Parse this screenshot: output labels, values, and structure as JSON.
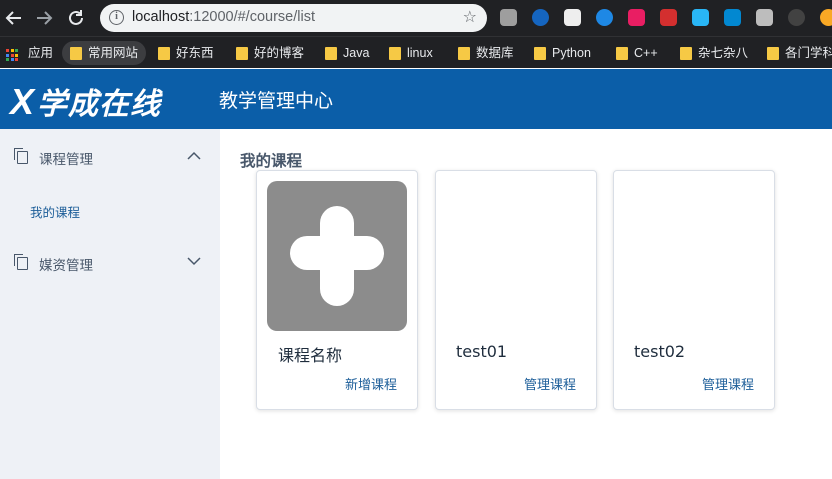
{
  "browser": {
    "url_host": "localhost",
    "url_rest": ":12000/#/course/list",
    "bookmarks": {
      "apps": "应用",
      "items": [
        "常用网站",
        "好东西",
        "好的博客",
        "Java",
        "linux",
        "数据库",
        "Python",
        "C++",
        "杂七杂八",
        "各门学科"
      ]
    }
  },
  "header": {
    "logo": "学成在线",
    "subtitle": "教学管理中心"
  },
  "sidebar": {
    "course_menu": "课程管理",
    "my_courses": "我的课程",
    "media_menu": "媒资管理"
  },
  "main": {
    "title": "我的课程",
    "cards": [
      {
        "name": "课程名称",
        "action": "新增课程"
      },
      {
        "name": "test01",
        "action": "管理课程"
      },
      {
        "name": "test02",
        "action": "管理课程"
      }
    ]
  },
  "colors": {
    "header_bg": "#0b5ea8",
    "sidebar_bg": "#eef1f6",
    "link": "#1d5e99",
    "thumb": "#8c8c8c"
  }
}
